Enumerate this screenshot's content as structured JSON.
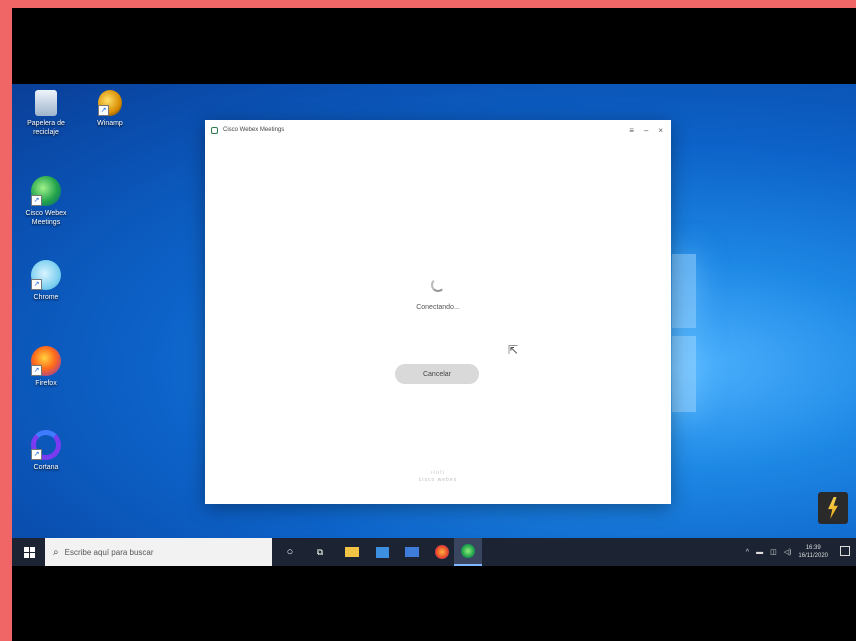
{
  "desktop": {
    "icons": [
      {
        "label": "Papelera de reciclaje",
        "icon": "recycle-bin-icon"
      },
      {
        "label": "Winamp",
        "icon": "winamp-icon"
      },
      {
        "label": "Cisco Webex Meetings",
        "icon": "webex-icon"
      },
      {
        "label": "Chrome",
        "icon": "chrome-icon"
      },
      {
        "label": "Firefox",
        "icon": "firefox-icon"
      },
      {
        "label": "Cortana",
        "icon": "cortana-icon"
      }
    ]
  },
  "window": {
    "title": "Cisco Webex Meetings",
    "status": "Conectando...",
    "cancel_label": "Cancelar",
    "footer_logo": "cisco webex"
  },
  "taskbar": {
    "search_placeholder": "Escribe aquí para buscar",
    "clock_time": "16:39",
    "clock_date": "16/11/2020"
  },
  "colors": {
    "frame": "#f06565",
    "taskbar": "#1c2433",
    "desktop": "#0d63c9"
  }
}
